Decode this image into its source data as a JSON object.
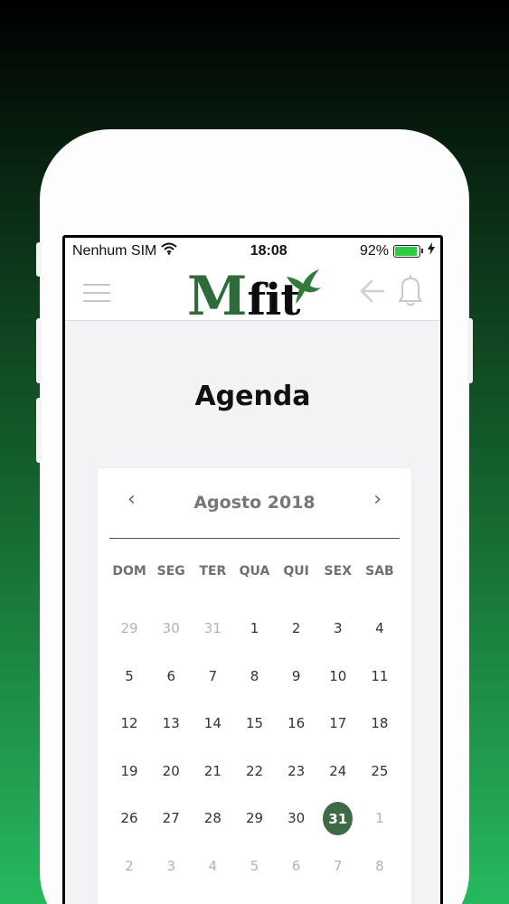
{
  "status_bar": {
    "carrier": "Nenhum SIM",
    "time": "18:08",
    "battery": "92%"
  },
  "header": {
    "logo_text_m": "M",
    "logo_text_fit": "fit"
  },
  "page": {
    "title": "Agenda"
  },
  "calendar": {
    "month_label": "Agosto 2018",
    "prev_label": "‹",
    "next_label": "›",
    "weekdays": [
      "DOM",
      "SEG",
      "TER",
      "QUA",
      "QUI",
      "SEX",
      "SAB"
    ],
    "days": [
      {
        "label": "29",
        "muted": true
      },
      {
        "label": "30",
        "muted": true
      },
      {
        "label": "31",
        "muted": true
      },
      {
        "label": "1"
      },
      {
        "label": "2"
      },
      {
        "label": "3"
      },
      {
        "label": "4"
      },
      {
        "label": "5"
      },
      {
        "label": "6"
      },
      {
        "label": "7"
      },
      {
        "label": "8"
      },
      {
        "label": "9"
      },
      {
        "label": "10"
      },
      {
        "label": "11"
      },
      {
        "label": "12"
      },
      {
        "label": "13"
      },
      {
        "label": "14"
      },
      {
        "label": "15"
      },
      {
        "label": "16"
      },
      {
        "label": "17"
      },
      {
        "label": "18"
      },
      {
        "label": "19"
      },
      {
        "label": "20"
      },
      {
        "label": "21"
      },
      {
        "label": "22"
      },
      {
        "label": "23"
      },
      {
        "label": "24"
      },
      {
        "label": "25"
      },
      {
        "label": "26"
      },
      {
        "label": "27"
      },
      {
        "label": "28"
      },
      {
        "label": "29"
      },
      {
        "label": "30"
      },
      {
        "label": "31",
        "selected": true
      },
      {
        "label": "1",
        "muted": true
      },
      {
        "label": "2",
        "muted": true
      },
      {
        "label": "3",
        "muted": true
      },
      {
        "label": "4",
        "muted": true
      },
      {
        "label": "5",
        "muted": true
      },
      {
        "label": "6",
        "muted": true
      },
      {
        "label": "7",
        "muted": true
      },
      {
        "label": "8",
        "muted": true
      }
    ]
  },
  "colors": {
    "accent": "#3d6a47",
    "battery": "#2ecc40",
    "background_top": "#000000",
    "background_bottom": "#27b95f"
  },
  "icons": [
    "menu-icon",
    "wifi-icon",
    "battery-icon",
    "charging-bolt-icon",
    "back-arrow-icon",
    "bell-icon",
    "bird-logo-icon",
    "chevron-left-icon",
    "chevron-right-icon"
  ]
}
